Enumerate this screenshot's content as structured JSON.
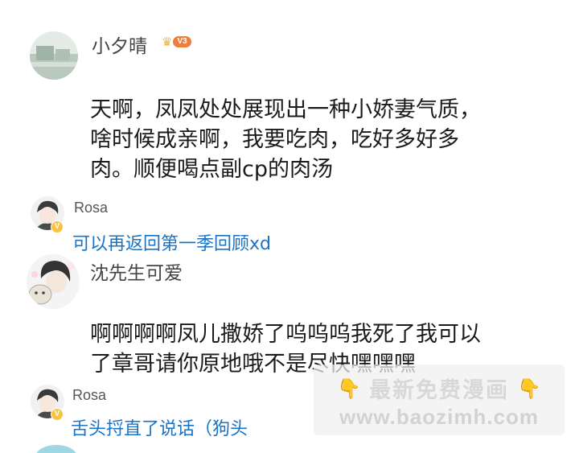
{
  "comments": [
    {
      "username": "小夕晴",
      "level_badge": "V3",
      "text_lines": [
        "天啊，凤凤处处展现出一种小娇妻气质，",
        "啥时候成亲啊，我要吃肉，吃好多好多",
        "肉。顺便喝点副cp的肉汤"
      ],
      "reply": {
        "username": "Rosa",
        "verified_mark": "V",
        "text": "可以再返回第一季回顾xd"
      }
    },
    {
      "username": "沈先生可爱",
      "text_lines": [
        "啊啊啊啊凤儿撒娇了呜呜呜我死了我可以",
        "了章哥请你原地哦不是尽快嘿嘿嘿"
      ],
      "reply": {
        "username": "Rosa",
        "verified_mark": "V",
        "text": "舌头捋直了说话（狗头"
      }
    }
  ],
  "watermark": {
    "title": "最新免费漫画",
    "url": "www.baozimh.com",
    "left_icon": "pointing-down-hand-icon",
    "right_icon": "pointing-down-hand-icon"
  },
  "colors": {
    "reply_link": "#1a73c4",
    "level_badge": "#ef7d3c",
    "verified_badge": "#f6c343"
  }
}
